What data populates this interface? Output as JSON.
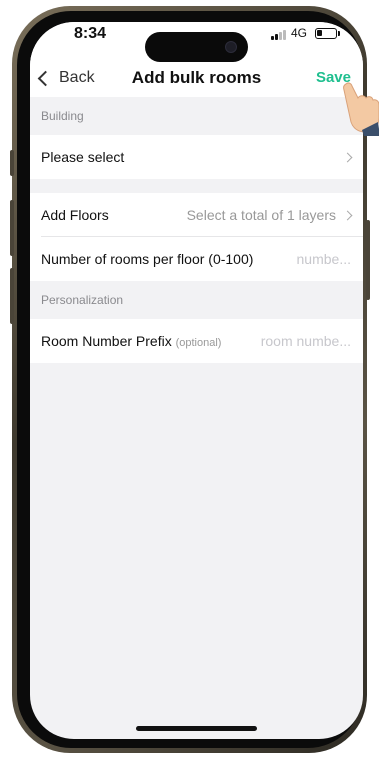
{
  "status": {
    "time": "8:34",
    "network": "4G"
  },
  "nav": {
    "back_label": "Back",
    "title": "Add bulk rooms",
    "save_label": "Save"
  },
  "sections": {
    "building": {
      "header": "Building",
      "rows": [
        {
          "label": "Please select",
          "value": ""
        }
      ]
    },
    "floors": {
      "rows": [
        {
          "label": "Add Floors",
          "value": "Select a total of 1 layers"
        },
        {
          "label": "Number of rooms per floor (0-100)",
          "placeholder": "numbe..."
        }
      ]
    },
    "personalization": {
      "header": "Personalization",
      "rows": [
        {
          "label": "Room Number Prefix",
          "note": "(optional)",
          "placeholder": "room numbe..."
        }
      ]
    }
  },
  "colors": {
    "accent": "#1fbf8f",
    "background": "#f2f2f4"
  },
  "icons": [
    "back-chevron-icon",
    "chevron-right-icon",
    "signal-icon",
    "battery-icon",
    "pointing-hand-icon"
  ]
}
